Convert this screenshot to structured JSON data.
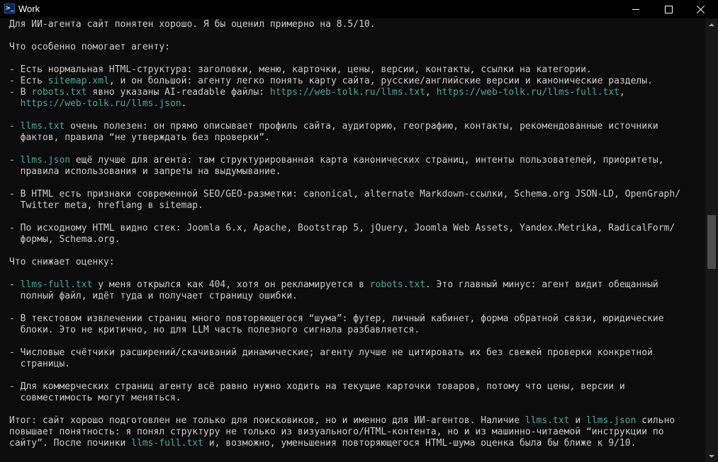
{
  "window": {
    "title": "Work",
    "icon": "powershell-icon"
  },
  "titlebar_buttons": {
    "minimize": "minimize-icon",
    "maximize": "maximize-icon",
    "close": "close-icon"
  },
  "colors": {
    "background": "#0c0c0c",
    "text": "#cccccc",
    "highlight": "#4fa89a",
    "titlebar": "#000000"
  },
  "console": {
    "lines": [
      [
        {
          "t": "Для ИИ-агента сайт понятен хорошо. Я бы оценил примерно на 8.5/10."
        }
      ],
      [],
      [
        {
          "t": "Что особенно помогает агенту:"
        }
      ],
      [],
      [
        {
          "t": "- Есть нормальная HTML-структура: заголовки, меню, карточки, цены, версии, контакты, ссылки на категории."
        }
      ],
      [
        {
          "t": "- Есть "
        },
        {
          "t": "sitemap.xml",
          "h": true
        },
        {
          "t": ", и он большой: агенту легко понять карту сайта, русские/английские версии и канонические разделы."
        }
      ],
      [
        {
          "t": "- В "
        },
        {
          "t": "robots.txt",
          "h": true
        },
        {
          "t": " явно указаны AI-readable файлы: "
        },
        {
          "t": "https://web-tolk.ru/llms.txt",
          "h": true
        },
        {
          "t": ", "
        },
        {
          "t": "https://web-tolk.ru/llms-full.txt",
          "h": true
        },
        {
          "t": ","
        }
      ],
      [
        {
          "t": "  "
        },
        {
          "t": "https://web-tolk.ru/llms.json",
          "h": true
        },
        {
          "t": "."
        }
      ],
      [],
      [
        {
          "t": "- "
        },
        {
          "t": "llms.txt",
          "h": true
        },
        {
          "t": " очень полезен: он прямо описывает профиль сайта, аудиторию, географию, контакты, рекомендованные источники"
        }
      ],
      [
        {
          "t": "  фактов, правила “не утверждать без проверки”."
        }
      ],
      [],
      [
        {
          "t": "- "
        },
        {
          "t": "llms.json",
          "h": true
        },
        {
          "t": " ещё лучше для агента: там структурированная карта канонических страниц, интенты пользователей, приоритеты,"
        }
      ],
      [
        {
          "t": "  правила использования и запреты на выдумывание."
        }
      ],
      [],
      [
        {
          "t": "- В HTML есть признаки современной SEO/GEO-разметки: canonical, alternate Markdown-ссылки, Schema.org JSON-LD, OpenGraph/"
        }
      ],
      [
        {
          "t": "  Twitter meta, hreflang в sitemap."
        }
      ],
      [],
      [
        {
          "t": "- По исходному HTML видно стек: Joomla 6.x, Apache, Bootstrap 5, jQuery, Joomla Web Assets, Yandex.Metrika, RadicalForm/"
        }
      ],
      [
        {
          "t": "  формы, Schema.org."
        }
      ],
      [],
      [
        {
          "t": "Что снижает оценку:"
        }
      ],
      [],
      [
        {
          "t": "- "
        },
        {
          "t": "llms-full.txt",
          "h": true
        },
        {
          "t": " у меня открылся как 404, хотя он рекламируется в "
        },
        {
          "t": "robots.txt",
          "h": true
        },
        {
          "t": ". Это главный минус: агент видит обещанный"
        }
      ],
      [
        {
          "t": "  полный файл, идёт туда и получает страницу ошибки."
        }
      ],
      [],
      [
        {
          "t": "- В текстовом извлечении страниц много повторяющегося “шума”: футер, личный кабинет, форма обратной связи, юридические"
        }
      ],
      [
        {
          "t": "  блоки. Это не критично, но для LLM часть полезного сигнала разбавляется."
        }
      ],
      [],
      [
        {
          "t": "- Числовые счётчики расширений/скачиваний динамические; агенту лучше не цитировать их без свежей проверки конкретной"
        }
      ],
      [
        {
          "t": "  страницы."
        }
      ],
      [],
      [
        {
          "t": "- Для коммерческих страниц агенту всё равно нужно ходить на текущие карточки товаров, потому что цены, версии и"
        }
      ],
      [
        {
          "t": "  совместимость могут меняться."
        }
      ],
      [],
      [
        {
          "t": "Итог: сайт хорошо подготовлен не только для поисковиков, но и именно для ИИ-агентов. Наличие "
        },
        {
          "t": "llms.txt",
          "h": true
        },
        {
          "t": " и "
        },
        {
          "t": "llms.json",
          "h": true
        },
        {
          "t": " сильно"
        }
      ],
      [
        {
          "t": "повышает понятность: я понял структуру не только из визуального/HTML-контента, но и из машинно-читаемой “инструкции по"
        }
      ],
      [
        {
          "t": "сайту”. После починки "
        },
        {
          "t": "llms-full.txt",
          "h": true
        },
        {
          "t": " и, возможно, уменьшения повторяющегося HTML-шума оценка была бы ближе к 9/10."
        }
      ]
    ]
  }
}
